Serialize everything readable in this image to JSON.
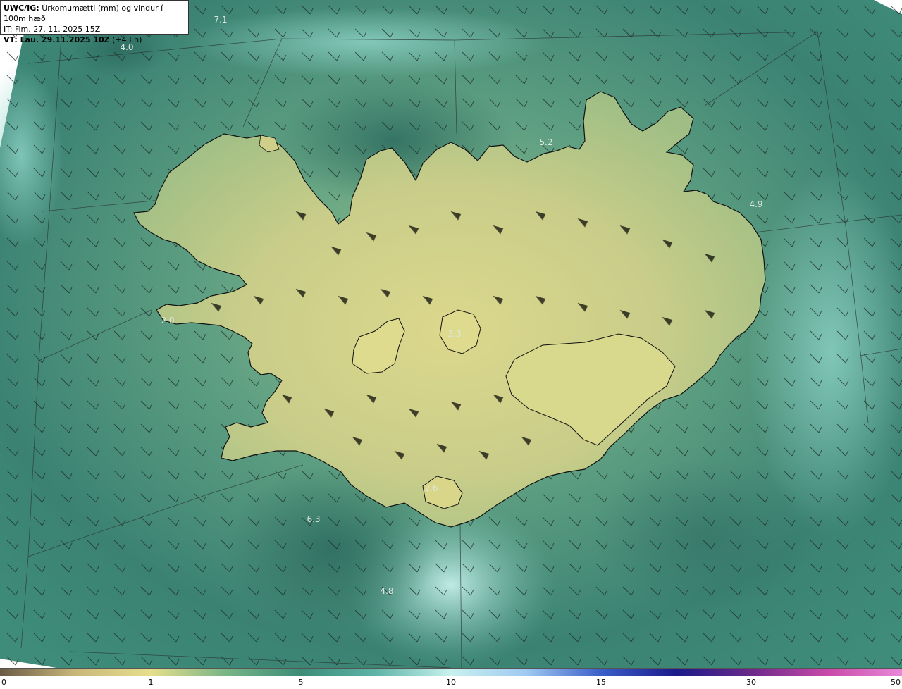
{
  "header": {
    "model_label": "UWC/IG:",
    "title": "Úrkomumætti (mm) og vindur í 100m hæð",
    "init_time": "IT: Fim. 27. 11. 2025 15Z",
    "valid_label": "VT: Lau. 29.11.2025 10Z",
    "valid_offset": "(+43 h)"
  },
  "map_labels": [
    {
      "text": "7.1"
    },
    {
      "text": "4.0"
    },
    {
      "text": "5.2"
    },
    {
      "text": "4.9"
    },
    {
      "text": "2.0"
    },
    {
      "text": "3.3"
    },
    {
      "text": "2.6"
    },
    {
      "text": "6.3"
    },
    {
      "text": "4.8"
    }
  ],
  "legend": {
    "ticks": [
      "0",
      "1",
      "5",
      "10",
      "15",
      "30",
      "50"
    ],
    "colors": [
      "#6b5a45",
      "#c8b77a",
      "#e6df8c",
      "#79b586",
      "#3c8c78",
      "#5fb4a8",
      "#c8f2ee",
      "#9fc9f2",
      "#3a5ec8",
      "#1b1a8a",
      "#6b2a8a",
      "#c84aa8",
      "#e888d8"
    ]
  },
  "colors": {
    "sea_dark": "#2f6e62",
    "sea_mid": "#4f9a86",
    "land_low": "#b8c787",
    "land_high": "#dbd98e",
    "coast": "#111111"
  }
}
